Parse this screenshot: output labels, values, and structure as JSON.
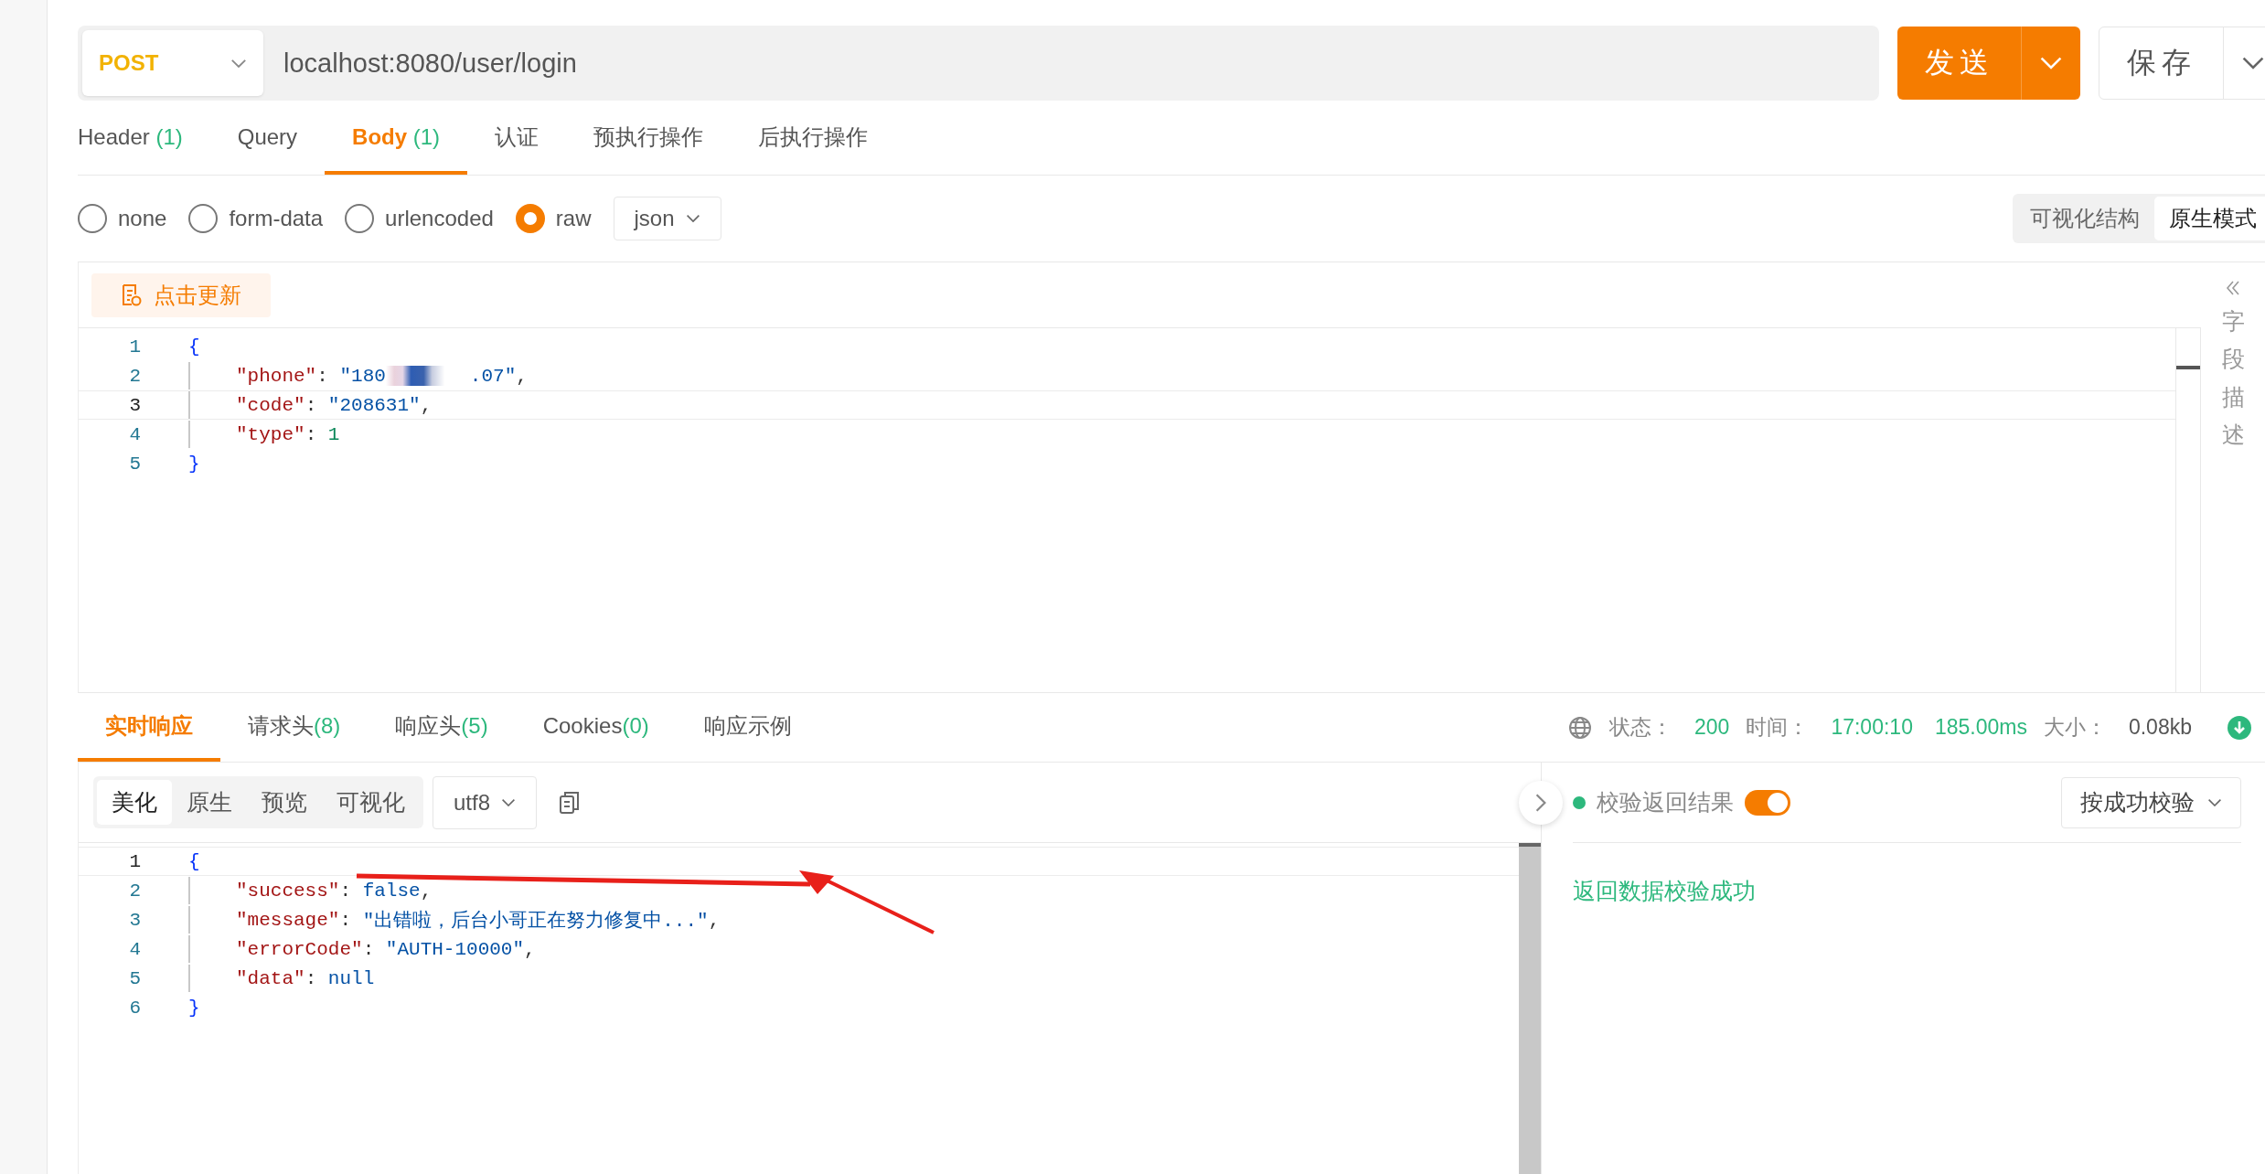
{
  "request": {
    "method": "POST",
    "url": "localhost:8080/user/login",
    "send_label": "发送",
    "save_label": "保存"
  },
  "request_tabs": [
    {
      "label": "Header",
      "count": "(1)",
      "selected": false
    },
    {
      "label": "Query",
      "selected": false
    },
    {
      "label": "Body",
      "count": "(1)",
      "selected": true
    },
    {
      "label": "认证",
      "selected": false
    },
    {
      "label": "预执行操作",
      "selected": false
    },
    {
      "label": "后执行操作",
      "selected": false
    }
  ],
  "body_types": [
    {
      "label": "none",
      "selected": false
    },
    {
      "label": "form-data",
      "selected": false
    },
    {
      "label": "urlencoded",
      "selected": false
    },
    {
      "label": "raw",
      "selected": true
    }
  ],
  "format": "json",
  "view_modes": [
    {
      "label": "可视化结构",
      "selected": false
    },
    {
      "label": "原生模式",
      "selected": true
    }
  ],
  "update_button": "点击更新",
  "request_code": [
    {
      "number": "1",
      "active": false,
      "indented": false,
      "tokens": [
        {
          "kind": "brace",
          "text": "{"
        }
      ]
    },
    {
      "number": "2",
      "active": false,
      "indented": true,
      "tokens": [
        {
          "kind": "key",
          "text": "\"phone\""
        },
        {
          "kind": "punct",
          "text": ": "
        },
        {
          "kind": "string",
          "text": "\"180"
        },
        {
          "kind": "redacted"
        },
        {
          "kind": "string",
          "text": ".07\""
        },
        {
          "kind": "punct",
          "text": ","
        }
      ]
    },
    {
      "number": "3",
      "active": true,
      "indented": true,
      "tokens": [
        {
          "kind": "key",
          "text": "\"code\""
        },
        {
          "kind": "punct",
          "text": ": "
        },
        {
          "kind": "string",
          "text": "\"208631\""
        },
        {
          "kind": "punct",
          "text": ","
        }
      ]
    },
    {
      "number": "4",
      "active": false,
      "indented": true,
      "tokens": [
        {
          "kind": "key",
          "text": "\"type\""
        },
        {
          "kind": "punct",
          "text": ": "
        },
        {
          "kind": "number",
          "text": "1"
        }
      ]
    },
    {
      "number": "5",
      "active": false,
      "indented": false,
      "tokens": [
        {
          "kind": "brace",
          "text": "}"
        }
      ]
    }
  ],
  "side_panel": {
    "label": "字段描述"
  },
  "response_tabs": [
    {
      "label": "实时响应",
      "selected": true
    },
    {
      "label": "请求头",
      "count": "(8)",
      "selected": false
    },
    {
      "label": "响应头",
      "count": "(5)",
      "selected": false
    },
    {
      "label": "Cookies",
      "count": "(0)",
      "selected": false
    },
    {
      "label": "响应示例",
      "selected": false
    }
  ],
  "status": [
    {
      "label": "状态：",
      "value": "200",
      "color": "#2db87d"
    },
    {
      "label": "时间：",
      "value": "17:00:10",
      "color": "#2db87d"
    },
    {
      "value": "185.00ms",
      "color": "#2db87d"
    },
    {
      "label": "大小：",
      "value": "0.08kb",
      "color": "#555555"
    }
  ],
  "response_views": [
    {
      "label": "美化",
      "selected": true
    },
    {
      "label": "原生",
      "selected": false
    },
    {
      "label": "预览",
      "selected": false
    },
    {
      "label": "可视化",
      "selected": false
    }
  ],
  "encoding": "utf8",
  "response_code": [
    {
      "number": "1",
      "active": true,
      "indented": false,
      "tokens": [
        {
          "kind": "brace",
          "text": "{"
        }
      ]
    },
    {
      "number": "2",
      "active": false,
      "indented": true,
      "tokens": [
        {
          "kind": "key",
          "text": "\"success\""
        },
        {
          "kind": "punct",
          "text": ": "
        },
        {
          "kind": "keyword",
          "text": "false"
        },
        {
          "kind": "punct",
          "text": ","
        }
      ]
    },
    {
      "number": "3",
      "active": false,
      "indented": true,
      "tokens": [
        {
          "kind": "key",
          "text": "\"message\""
        },
        {
          "kind": "punct",
          "text": ": "
        },
        {
          "kind": "string",
          "text": "\"出错啦，后台小哥正在努力修复中...\""
        },
        {
          "kind": "punct",
          "text": ","
        }
      ]
    },
    {
      "number": "4",
      "active": false,
      "indented": true,
      "tokens": [
        {
          "kind": "key",
          "text": "\"errorCode\""
        },
        {
          "kind": "punct",
          "text": ": "
        },
        {
          "kind": "string",
          "text": "\"AUTH-10000\""
        },
        {
          "kind": "punct",
          "text": ","
        }
      ]
    },
    {
      "number": "5",
      "active": false,
      "indented": true,
      "tokens": [
        {
          "kind": "key",
          "text": "\"data\""
        },
        {
          "kind": "punct",
          "text": ": "
        },
        {
          "kind": "keyword",
          "text": "null"
        }
      ]
    },
    {
      "number": "6",
      "active": false,
      "indented": false,
      "tokens": [
        {
          "kind": "brace",
          "text": "}"
        }
      ]
    }
  ],
  "validation": {
    "color": "#2db87d",
    "label": "校验返回结果",
    "on": true,
    "mode": "按成功校验",
    "result": "返回数据校验成功"
  }
}
